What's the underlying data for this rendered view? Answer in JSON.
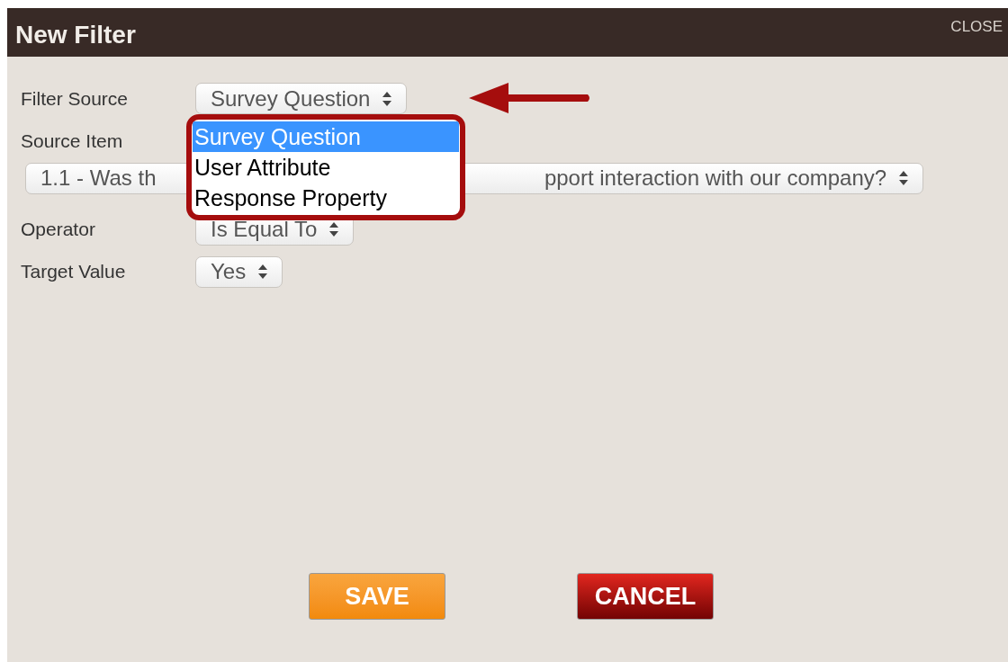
{
  "dialog": {
    "title": "New Filter",
    "close": "CLOSE"
  },
  "fields": [
    {
      "label": "Filter Source",
      "value": "Survey Question",
      "kind": "inline"
    },
    {
      "label": "Source Item",
      "value_start": "1.1 - Was th",
      "value_end": "pport interaction with our company?",
      "kind": "stacked"
    },
    {
      "label": "Operator",
      "value": "Is Equal To",
      "kind": "inline"
    },
    {
      "label": "Target Value",
      "value": "Yes",
      "kind": "inline"
    }
  ],
  "dropdown": {
    "options": [
      {
        "label": "Survey Question",
        "selected": true
      },
      {
        "label": "User Attribute",
        "selected": false
      },
      {
        "label": "Response Property",
        "selected": false
      }
    ]
  },
  "buttons": [
    {
      "label": "SAVE",
      "kind": "primary"
    },
    {
      "label": "CANCEL",
      "kind": "danger"
    }
  ]
}
